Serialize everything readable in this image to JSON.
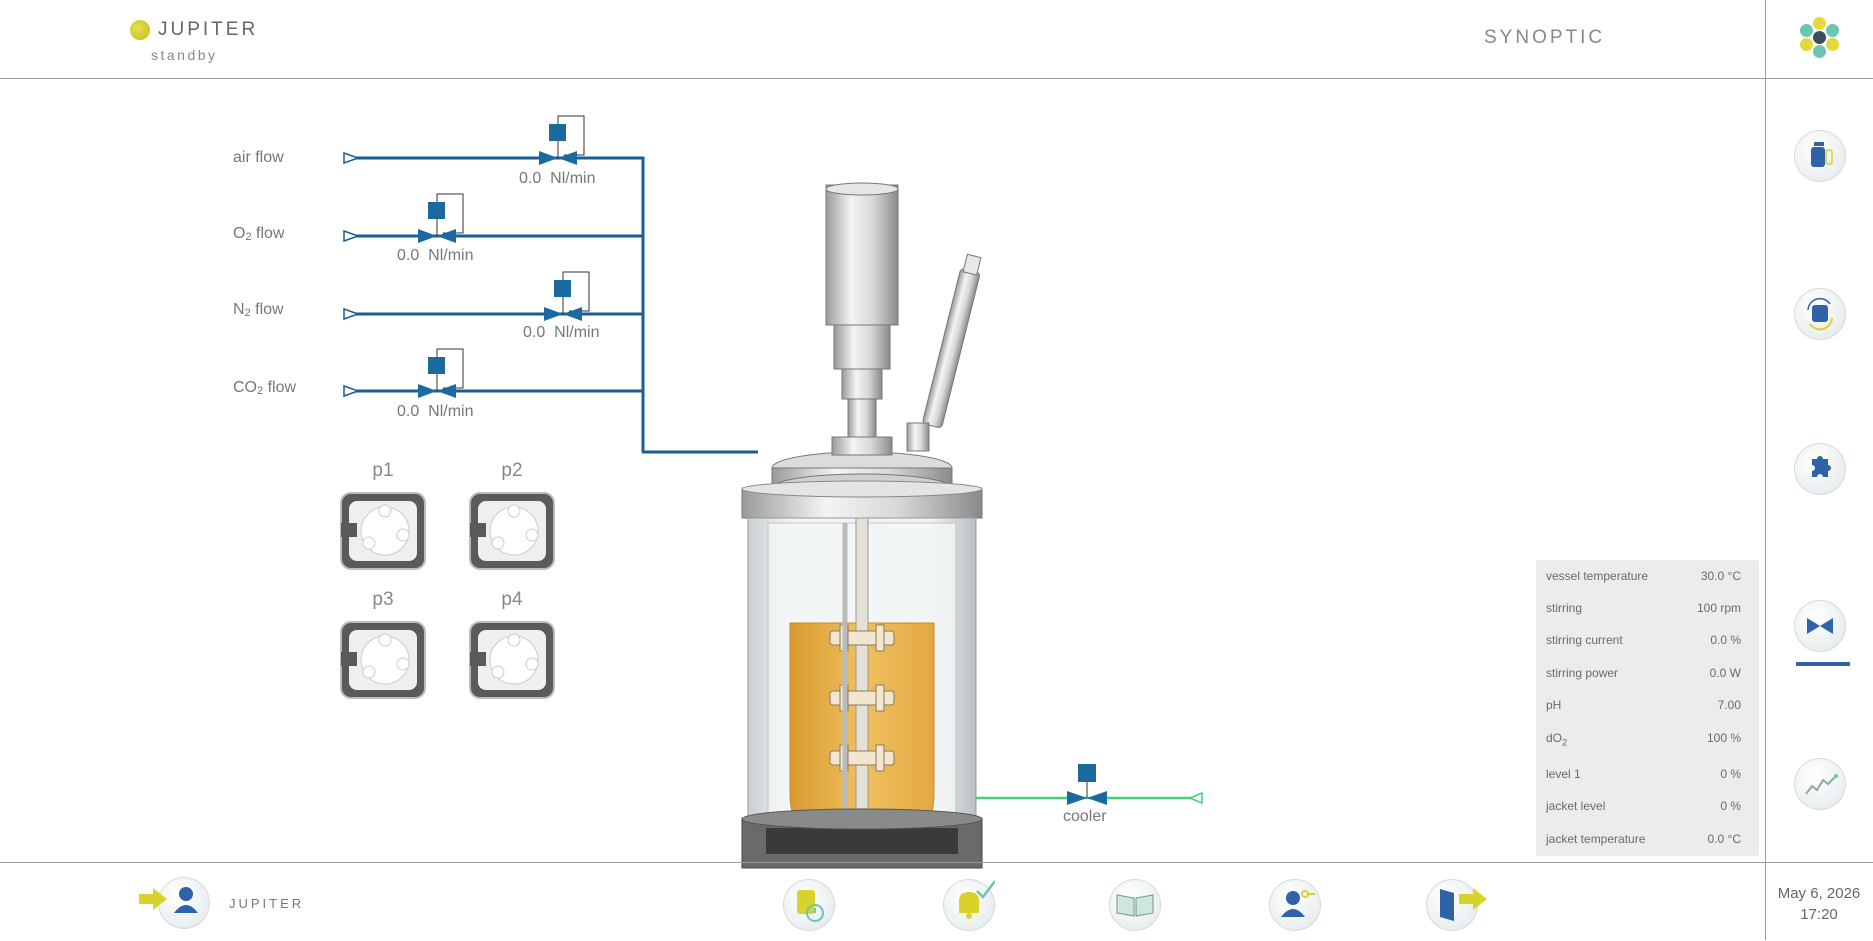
{
  "header": {
    "app_name": "JUPITER",
    "status": "standby",
    "page_title": "SYNOPTIC"
  },
  "gas_lines": [
    {
      "label": "air flow",
      "value": "0.0",
      "unit": "Nl/min"
    },
    {
      "label_main": "O",
      "label_sub": "2",
      "label_rest": " flow",
      "value": "0.0",
      "unit": "Nl/min"
    },
    {
      "label_main": "N",
      "label_sub": "2",
      "label_rest": " flow",
      "value": "0.0",
      "unit": "Nl/min"
    },
    {
      "label_main": "CO",
      "label_sub": "2",
      "label_rest": " flow",
      "value": "0.0",
      "unit": "Nl/min"
    }
  ],
  "pumps": [
    {
      "label": "p1"
    },
    {
      "label": "p2"
    },
    {
      "label": "p3"
    },
    {
      "label": "p4"
    }
  ],
  "cooler": {
    "label": "cooler"
  },
  "readings": [
    {
      "label": "vessel temperature",
      "value": "30.0 °C"
    },
    {
      "label": "stirring",
      "value": "100 rpm"
    },
    {
      "label": "stirring current",
      "value": "0.0 %"
    },
    {
      "label": "stirring power",
      "value": "0.0 W"
    },
    {
      "label": "pH",
      "value": "7.00"
    },
    {
      "label_main": "dO",
      "label_sub": "2",
      "value": "100 %"
    },
    {
      "label": "level 1",
      "value": "0 %"
    },
    {
      "label": "jacket level",
      "value": "0 %"
    },
    {
      "label": "jacket temperature",
      "value": "0.0 °C"
    }
  ],
  "sidebar": {
    "items": [
      {
        "icon": "reactor-config-icon"
      },
      {
        "icon": "cycle-icon"
      },
      {
        "icon": "puzzle-icon"
      },
      {
        "icon": "valve-icon",
        "active": true
      },
      {
        "icon": "trend-chart-icon"
      }
    ]
  },
  "footer": {
    "user_label": "JUPITER",
    "date": "May 6, 2026",
    "time": "17:20"
  },
  "colors": {
    "pipe_blue": "#1a5e96",
    "valve_blue": "#1a6aa0",
    "cooler_green": "#3fd27a",
    "accent_yellow": "#d8d22a",
    "active_underline": "#2f62a6"
  }
}
